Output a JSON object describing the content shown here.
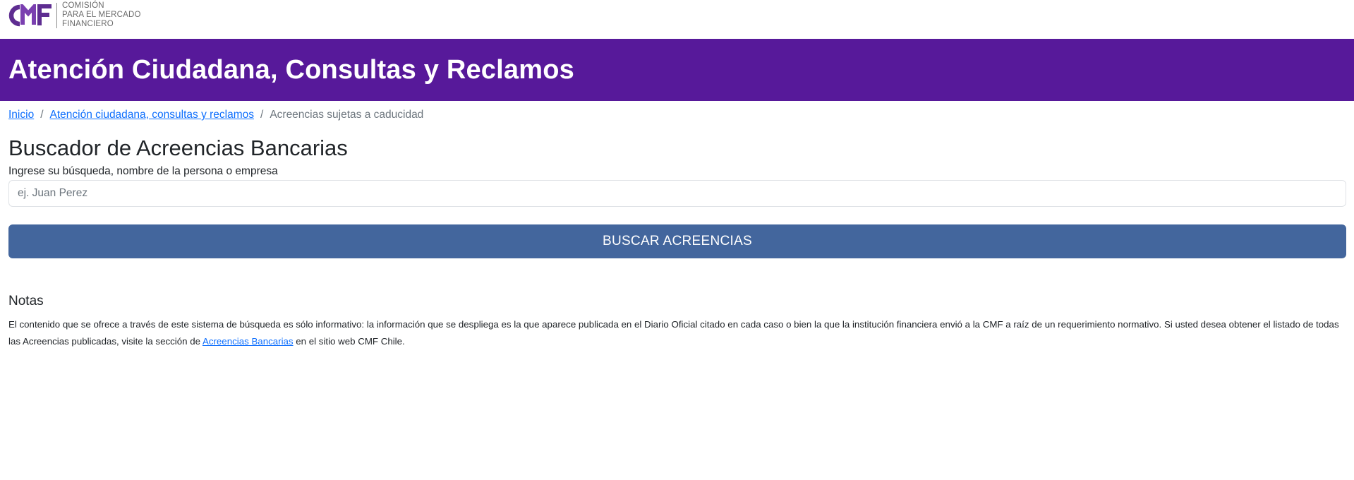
{
  "colors": {
    "brand_purple": "#57199a",
    "button_blue": "#43669d",
    "link_blue": "#0d6efd",
    "logo_purple": "#5e2d91"
  },
  "logo": {
    "mark": "CMF",
    "line1": "COMISIÓN",
    "line2": "PARA EL MERCADO",
    "line3": "FINANCIERO"
  },
  "banner": {
    "title": "Atención Ciudadana, Consultas y Reclamos"
  },
  "breadcrumb": {
    "items": [
      {
        "label": "Inicio"
      },
      {
        "label": "Atención ciudadana, consultas y reclamos"
      }
    ],
    "current": "Acreencias sujetas a caducidad",
    "separator": "/"
  },
  "search": {
    "heading": "Buscador de Acreencias Bancarias",
    "label": "Ingrese su búsqueda, nombre de la persona o empresa",
    "value": "",
    "placeholder": "ej. Juan Perez",
    "button_label": "BUSCAR ACREENCIAS"
  },
  "notes": {
    "title": "Notas",
    "text_before": "El contenido que se ofrece a través de este sistema de búsqueda es sólo informativo: la información que se despliega es la que aparece publicada en el Diario Oficial citado en cada caso o bien la que la institución financiera envió a la CMF a raíz de un requerimiento normativo. Si usted desea obtener el listado de todas las Acreencias publicadas, visite la sección de ",
    "link_label": "Acreencias Bancarias",
    "text_after": " en el sitio web CMF Chile."
  }
}
